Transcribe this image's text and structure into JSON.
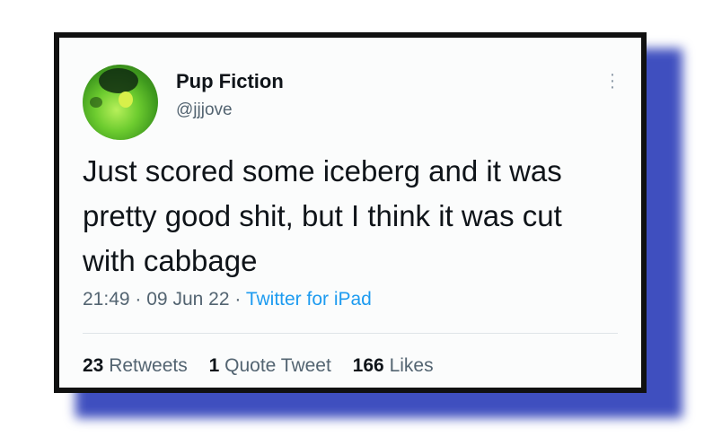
{
  "tweet": {
    "display_name": "Pup Fiction",
    "handle": "@jjjove",
    "text": "Just scored some iceberg and it was pretty good shit, but I think it was cut with cabbage",
    "time": "21:49",
    "date": "09 Jun 22",
    "source": "Twitter for iPad",
    "separator": "·",
    "stats": {
      "retweets_count": "23",
      "retweets_label": "Retweets",
      "quotes_count": "1",
      "quotes_label": "Quote Tweet",
      "likes_count": "166",
      "likes_label": "Likes"
    }
  },
  "icons": {
    "more": "more-options-icon",
    "avatar": "avatar"
  },
  "colors": {
    "frame": "#111111",
    "shadow": "#3f4fbf",
    "link": "#1d9bf0",
    "muted": "#536471",
    "text": "#0f1419"
  }
}
